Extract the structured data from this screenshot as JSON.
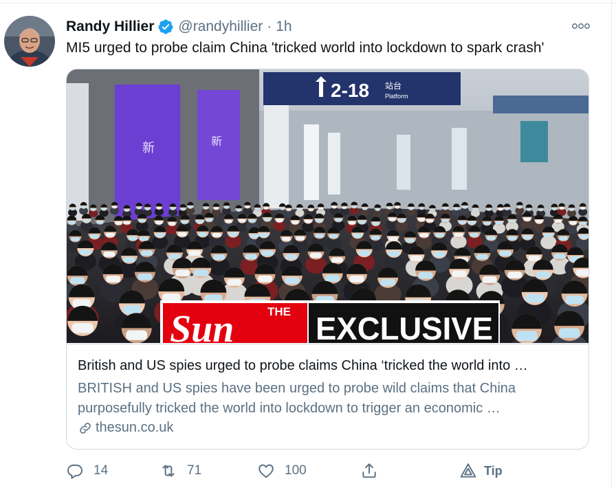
{
  "tweet": {
    "author_name": "Randy Hillier",
    "handle": "@randyhillier",
    "separator": "·",
    "time": "1h",
    "text": "MI5 urged to probe claim China 'tricked world into lockdown to spark crash'"
  },
  "card": {
    "image_sign_text": "2-18",
    "image_sign_subtext": "站台",
    "image_sign_subtext2": "Platform",
    "banner_brand": "THE",
    "banner_brand2": "Sun",
    "banner_label": "EXCLUSIVE",
    "title": "British and US spies urged to probe claims China ‘tricked the world into …",
    "description_line1": "BRITISH and US spies have been urged to probe wild claims that China",
    "description_line2": "purposefully tricked the world into lockdown to trigger an economic …",
    "domain": "thesun.co.uk"
  },
  "actions": {
    "reply_count": "14",
    "retweet_count": "71",
    "like_count": "100",
    "tip_label": "Tip"
  },
  "icons": {
    "more": "more-options-icon",
    "verified": "verified-badge-icon",
    "link": "link-icon",
    "reply": "reply-icon",
    "retweet": "retweet-icon",
    "like": "like-icon",
    "share": "share-icon",
    "tip": "tip-icon"
  },
  "colors": {
    "verified_blue": "#1da1f2",
    "secondary_text": "#5b7083",
    "sun_red": "#e3000f"
  }
}
